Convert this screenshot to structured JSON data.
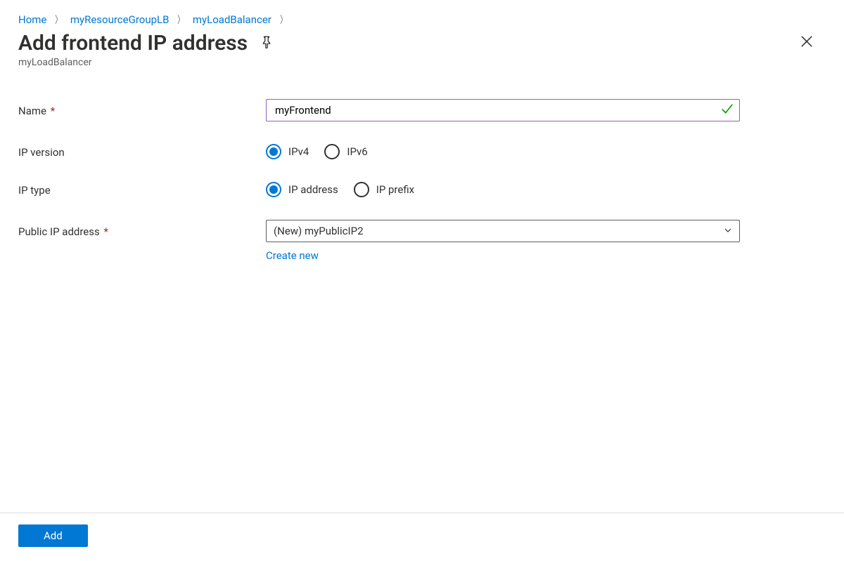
{
  "breadcrumb": {
    "items": [
      {
        "label": "Home"
      },
      {
        "label": "myResourceGroupLB"
      },
      {
        "label": "myLoadBalancer"
      }
    ]
  },
  "header": {
    "title": "Add frontend IP address",
    "subtitle": "myLoadBalancer"
  },
  "form": {
    "name": {
      "label": "Name",
      "value": "myFrontend",
      "required": true
    },
    "ip_version": {
      "label": "IP version",
      "options": {
        "ipv4": "IPv4",
        "ipv6": "IPv6"
      },
      "selected": "ipv4"
    },
    "ip_type": {
      "label": "IP type",
      "options": {
        "address": "IP address",
        "prefix": "IP prefix"
      },
      "selected": "address"
    },
    "public_ip": {
      "label": "Public IP address",
      "value": "(New) myPublicIP2",
      "required": true,
      "create_new": "Create new"
    }
  },
  "footer": {
    "add": "Add"
  }
}
